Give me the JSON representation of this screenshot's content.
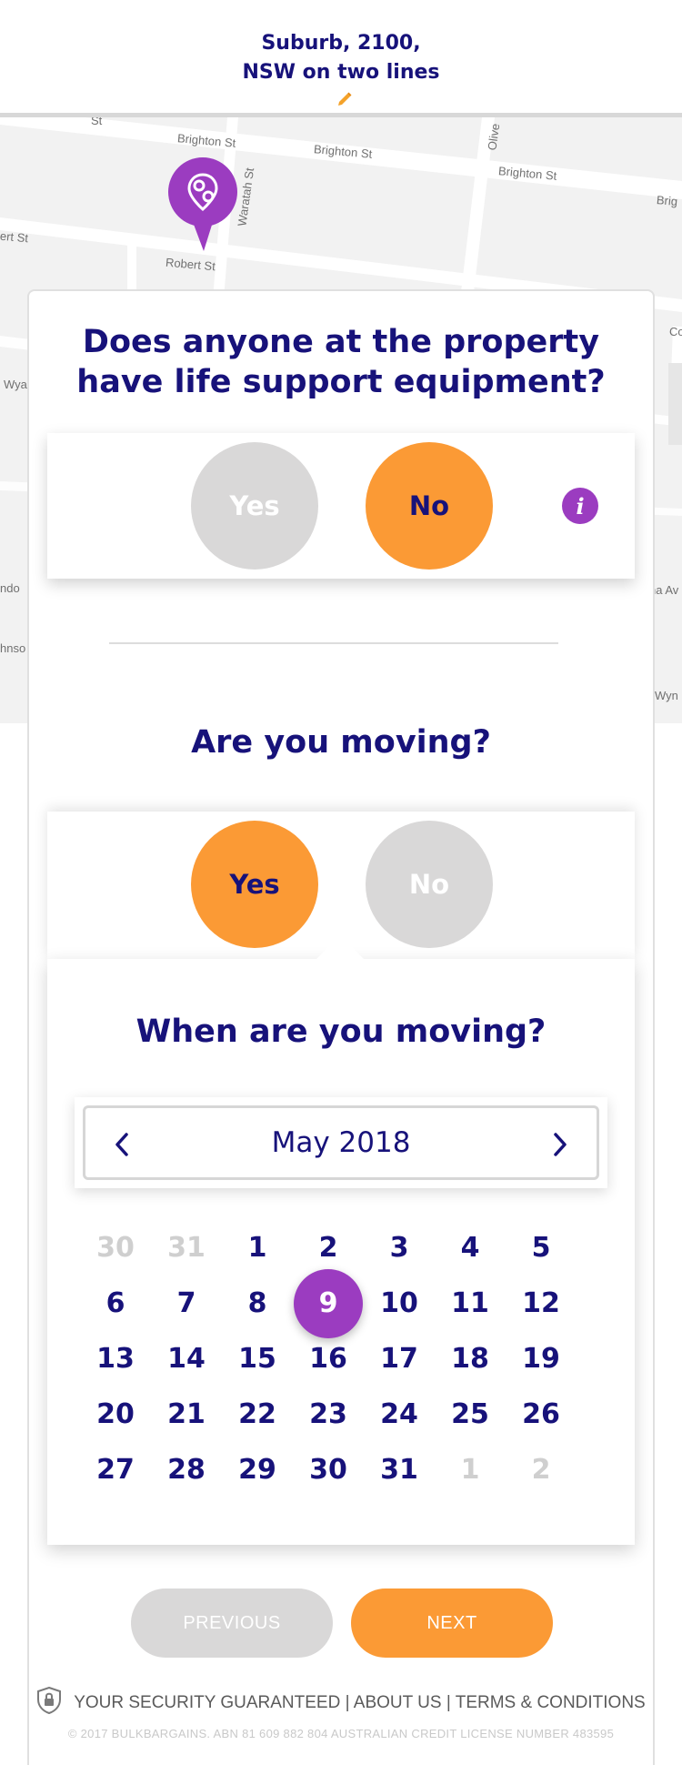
{
  "header": {
    "address_line1": "Suburb, 2100,",
    "address_line2": "NSW on two lines",
    "edit_icon": "pencil-icon"
  },
  "map": {
    "streets": [
      "Brighton St",
      "Brighton St",
      "Brighton St",
      "Brig",
      "Robert St",
      "ert St",
      "Waratah St",
      "Olive",
      "Wya",
      "Co",
      "ndo",
      "hnso",
      "na Av",
      "Wyn",
      "St"
    ],
    "pin_icon": "location-pin-icon"
  },
  "life_support": {
    "question_line1": "Does anyone at the property",
    "question_line2": "have life support equipment?",
    "yes_label": "Yes",
    "no_label": "No",
    "selected": "No",
    "info_icon": "info-icon",
    "info_glyph": "i"
  },
  "moving": {
    "question": "Are you moving?",
    "yes_label": "Yes",
    "no_label": "No",
    "selected": "Yes"
  },
  "move_date": {
    "question": "When are you moving?",
    "month_label": "May 2018",
    "selected_day": "9",
    "weeks": [
      [
        {
          "d": "30",
          "muted": true
        },
        {
          "d": "31",
          "muted": true
        },
        {
          "d": "1"
        },
        {
          "d": "2"
        },
        {
          "d": "3"
        },
        {
          "d": "4"
        },
        {
          "d": "5"
        }
      ],
      [
        {
          "d": "6"
        },
        {
          "d": "7"
        },
        {
          "d": "8"
        },
        {
          "d": "9",
          "selected": true
        },
        {
          "d": "10"
        },
        {
          "d": "11"
        },
        {
          "d": "12"
        }
      ],
      [
        {
          "d": "13"
        },
        {
          "d": "14"
        },
        {
          "d": "15"
        },
        {
          "d": "16"
        },
        {
          "d": "17"
        },
        {
          "d": "18"
        },
        {
          "d": "19"
        }
      ],
      [
        {
          "d": "20"
        },
        {
          "d": "21"
        },
        {
          "d": "22"
        },
        {
          "d": "23"
        },
        {
          "d": "24"
        },
        {
          "d": "25"
        },
        {
          "d": "26"
        }
      ],
      [
        {
          "d": "27"
        },
        {
          "d": "28"
        },
        {
          "d": "29"
        },
        {
          "d": "30"
        },
        {
          "d": "31"
        },
        {
          "d": "1",
          "muted": true
        },
        {
          "d": "2",
          "muted": true
        }
      ]
    ]
  },
  "actions": {
    "previous_label": "PREVIOUS",
    "next_label": "NEXT"
  },
  "footer": {
    "security": "YOUR SECURITY GUARANTEED",
    "separator": "|",
    "about": "ABOUT US",
    "terms": "TERMS & CONDITIONS",
    "legal": "© 2017 BULKBARGAINS. ABN 81 609 882 804 AUSTRALIAN CREDIT LICENSE NUMBER 483595"
  },
  "colors": {
    "navy": "#17127a",
    "orange": "#fb9a35",
    "purple": "#9b3cc0",
    "grey": "#d9d8d8"
  }
}
